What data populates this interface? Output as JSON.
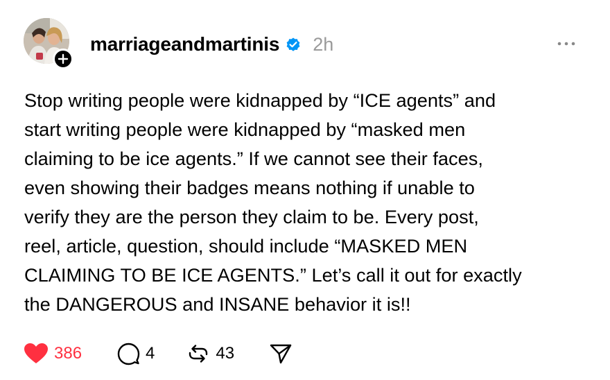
{
  "post": {
    "username": "marriageandmartinis",
    "timestamp": "2h",
    "verified": true,
    "text_lines": [
      "Stop writing people were kidnapped by “ICE agents” and",
      "start writing people were kidnapped by “masked men",
      "claiming to be ice agents.” If we cannot see their faces,",
      "even showing their badges means nothing if unable to",
      "verify they are the person they claim to be. Every post,",
      "reel, article, question, should include “MASKED MEN",
      "CLAIMING TO BE ICE AGENTS.” Let’s call it out for exactly",
      "the DANGEROUS and INSANE behavior it is!!"
    ]
  },
  "actions": {
    "likes": "386",
    "replies": "4",
    "reposts": "43"
  },
  "icons": {
    "avatar": "avatar",
    "follow": "plus-icon",
    "verified": "verified-badge-icon",
    "more": "more-options-icon",
    "like": "heart-icon",
    "reply": "comment-icon",
    "repost": "repost-icon",
    "share": "send-icon"
  },
  "colors": {
    "like_active": "#ff3040",
    "verified": "#0095f6",
    "muted": "#9a9a9a"
  }
}
